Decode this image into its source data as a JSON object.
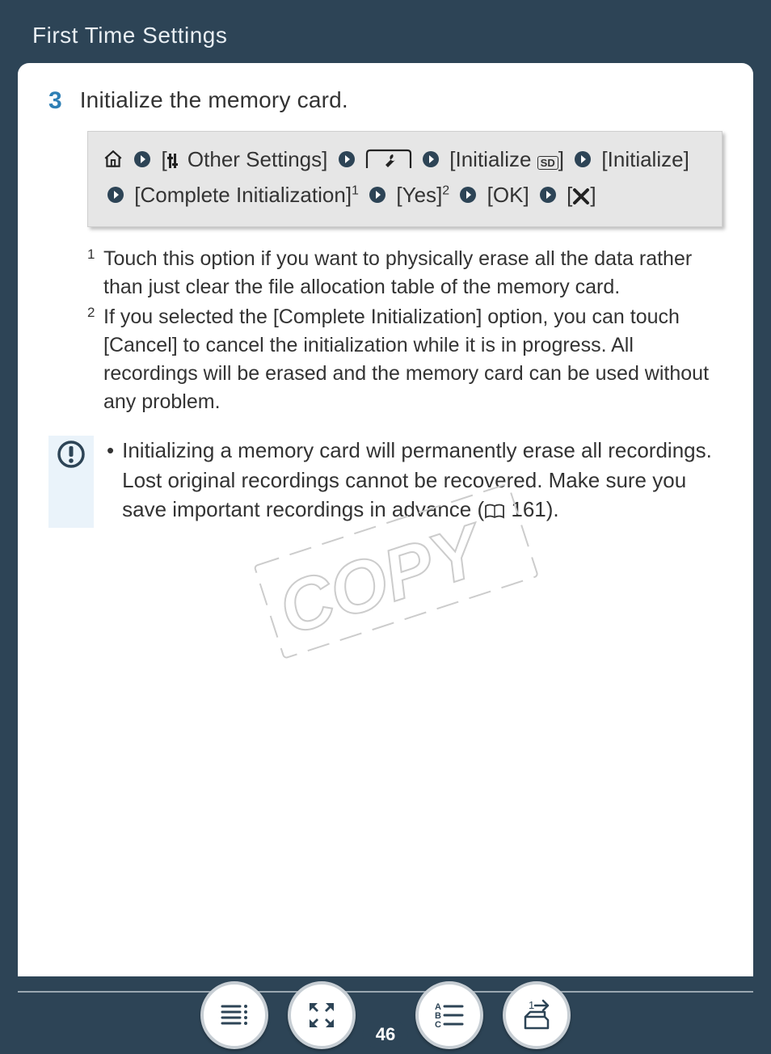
{
  "header": {
    "title": "First Time Settings"
  },
  "step": {
    "number": "3",
    "title": "Initialize the memory card."
  },
  "navpath": {
    "item1": "Other Settings",
    "item2": "Initialize",
    "sd_label": "SD",
    "item3": "Initialize",
    "item4": "Complete Initialization",
    "sup1": "1",
    "item5": "Yes",
    "sup2": "2",
    "item6": "OK"
  },
  "footnotes": {
    "n1": "1",
    "t1": "Touch this option if you want to physically erase all the data rather than just clear the file allocation table of the memory card.",
    "n2": "2",
    "t2": "If you selected the [Complete Initialization] option, you can touch [Cancel] to cancel the initialization while it is in progress. All recordings will be erased and the memory card can be used without any problem."
  },
  "caution": {
    "text_a": "Initializing a memory card will permanently erase all recordings. Lost original recordings cannot be recov­ered. Make sure you save important recordings in advance (",
    "page_ref": "161",
    "text_b": ")."
  },
  "watermark": {
    "text": "COPY"
  },
  "bottom": {
    "page": "46"
  }
}
